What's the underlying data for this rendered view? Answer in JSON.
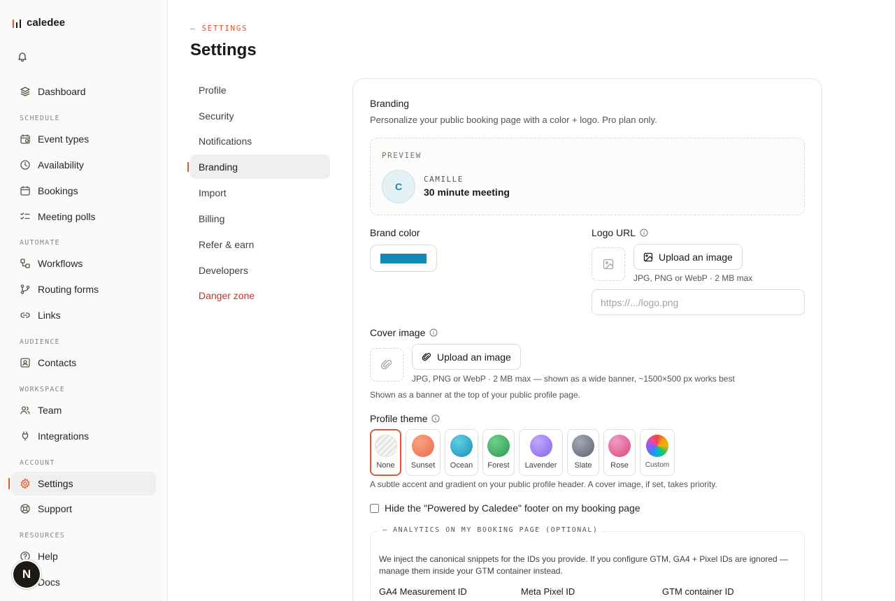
{
  "app": {
    "name": "caledee"
  },
  "colors": {
    "accent": "#e4572e",
    "brand": "#118ab2",
    "danger": "#c53030"
  },
  "sidebar": {
    "notifications_icon": "bell-icon",
    "sections": {
      "schedule": "SCHEDULE",
      "automate": "AUTOMATE",
      "audience": "AUDIENCE",
      "workspace": "WORKSPACE",
      "account": "ACCOUNT",
      "resources": "RESOURCES"
    },
    "items": {
      "dashboard": "Dashboard",
      "event_types": "Event types",
      "availability": "Availability",
      "bookings": "Bookings",
      "meeting_polls": "Meeting polls",
      "workflows": "Workflows",
      "routing_forms": "Routing forms",
      "links": "Links",
      "contacts": "Contacts",
      "team": "Team",
      "integrations": "Integrations",
      "settings": "Settings",
      "support": "Support",
      "help": "Help",
      "docs": "Docs"
    },
    "active": "settings",
    "fab_label": "N"
  },
  "header": {
    "eyebrow": "— SETTINGS",
    "title": "Settings"
  },
  "settings_nav": {
    "items": [
      "Profile",
      "Security",
      "Notifications",
      "Branding",
      "Import",
      "Billing",
      "Refer & earn",
      "Developers",
      "Danger zone"
    ],
    "active": "Branding"
  },
  "branding": {
    "title": "Branding",
    "subtitle": "Personalize your public booking page with a color + logo. Pro plan only.",
    "preview": {
      "label": "PREVIEW",
      "avatar_initial": "C",
      "host_name": "CAMILLE",
      "meeting_title": "30 minute meeting"
    },
    "brand_color": {
      "label": "Brand color",
      "value": "#118ab2"
    },
    "logo": {
      "label": "Logo URL",
      "upload_label": "Upload an image",
      "hint": "JPG, PNG or WebP · 2 MB max",
      "input_value": "",
      "input_placeholder": "https://.../logo.png"
    },
    "cover": {
      "label": "Cover image",
      "upload_label": "Upload an image",
      "hint": "JPG, PNG or WebP · 2 MB max — shown as a wide banner, ~1500×500 px works best",
      "description": "Shown as a banner at the top of your public profile page."
    },
    "theme": {
      "label": "Profile theme",
      "selected": "None",
      "options": [
        {
          "name": "None",
          "color": "none"
        },
        {
          "name": "Sunset",
          "color": "#f07b5e"
        },
        {
          "name": "Ocean",
          "color": "#2aa9c9"
        },
        {
          "name": "Forest",
          "color": "#3fae5f"
        },
        {
          "name": "Lavender",
          "color": "#9b7bf0"
        },
        {
          "name": "Slate",
          "color": "#6b7280"
        },
        {
          "name": "Rose",
          "color": "#e0609a"
        },
        {
          "name": "Custom",
          "color": "rainbow"
        }
      ],
      "description": "A subtle accent and gradient on your public profile header. A cover image, if set, takes priority."
    },
    "hide_footer": {
      "label": "Hide the \"Powered by Caledee\" footer on my booking page",
      "checked": false
    },
    "analytics": {
      "legend": "— ANALYTICS ON MY BOOKING PAGE (OPTIONAL)",
      "description": "We inject the canonical snippets for the IDs you provide. If you configure GTM, GA4 + Pixel IDs are ignored — manage them inside your GTM container instead.",
      "fields": [
        "GA4 Measurement ID",
        "Meta Pixel ID",
        "GTM container ID"
      ]
    }
  }
}
